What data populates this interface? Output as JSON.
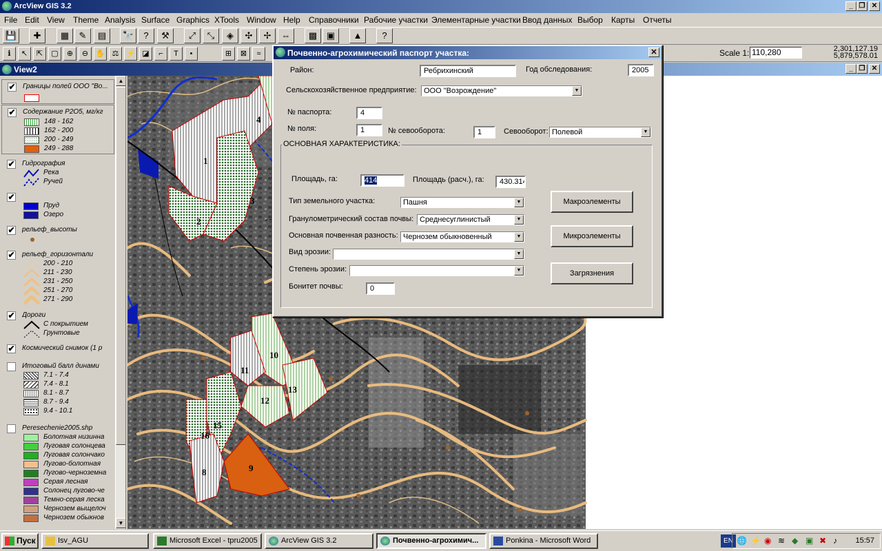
{
  "app": {
    "title": "ArcView GIS 3.2"
  },
  "menu": [
    "File",
    "Edit",
    "View",
    "Theme",
    "Analysis",
    "Surface",
    "Graphics",
    "XTools",
    "Window",
    "Help",
    "Справочники",
    "Рабочие участки",
    "Элементарные участки",
    "Ввод данных",
    "Выбор",
    "Карты",
    "Отчеты"
  ],
  "toolbar": {
    "scale_label": "Scale 1:",
    "scale_value": "110,280",
    "coord_x": "2,301,127.19",
    "coord_y": "5,879,578.01"
  },
  "view": {
    "title": "View2"
  },
  "toc": {
    "themes": [
      {
        "title": "Границы полей ООО \"Во...",
        "items": [
          {
            "label": "",
            "color": "#ffffff"
          }
        ]
      },
      {
        "title": "Содержание P2O5, мг/кг",
        "items": [
          {
            "label": "148 - 162",
            "color": "#eaffd8"
          },
          {
            "label": "162 - 200",
            "color": "#ffffff"
          },
          {
            "label": "200 - 249",
            "color": "#8fc08f"
          },
          {
            "label": "249 - 288",
            "color": "#e06010"
          }
        ]
      },
      {
        "title": "Гидрография",
        "items": [
          {
            "label": "Река"
          },
          {
            "label": "Ручей"
          }
        ]
      },
      {
        "title": "",
        "items": [
          {
            "label": "Пруд",
            "color": "#0000cc"
          },
          {
            "label": "Озеро",
            "color": "#1010a0"
          }
        ]
      },
      {
        "title": "рельеф_высоты",
        "items": []
      },
      {
        "title": "рельеф_горизонтали",
        "items": [
          {
            "label": "200 - 210"
          },
          {
            "label": "211 - 230"
          },
          {
            "label": "231 - 250"
          },
          {
            "label": "251 - 270"
          },
          {
            "label": "271 - 290"
          }
        ]
      },
      {
        "title": "Дороги",
        "items": [
          {
            "label": "С покрытием"
          },
          {
            "label": "Грунтовые"
          }
        ]
      },
      {
        "title": "Космический снимок (1 р",
        "items": []
      },
      {
        "title": "Итоговый балл динами",
        "items": [
          {
            "label": "7.1 - 7.4"
          },
          {
            "label": "7.4 - 8.1"
          },
          {
            "label": "8.1 - 8.7"
          },
          {
            "label": "8.7 - 9.4"
          },
          {
            "label": "9.4 - 10.1"
          }
        ]
      },
      {
        "title": "Peresechenie2005.shp",
        "items": [
          {
            "label": "Болотная низинна",
            "color": "#a0f0a0"
          },
          {
            "label": "Луговая солонцева",
            "color": "#40d040"
          },
          {
            "label": "Луговая солончако",
            "color": "#20b020"
          },
          {
            "label": "Лугово-болотная",
            "color": "#f0c090"
          },
          {
            "label": "Лугово-черноземна",
            "color": "#208020"
          },
          {
            "label": "Серая лесная",
            "color": "#c040c0"
          },
          {
            "label": "Солонец лугово-че",
            "color": "#303090"
          },
          {
            "label": "Темно-серая леска",
            "color": "#a040a0"
          },
          {
            "label": "Чернозем выщелоч",
            "color": "#d0a080"
          },
          {
            "label": "Чернозем обыкнов",
            "color": "#c07040"
          }
        ]
      }
    ]
  },
  "map": {
    "field_numbers": [
      "1",
      "2",
      "3",
      "4",
      "8",
      "9",
      "10",
      "11",
      "12",
      "13",
      "15",
      "16"
    ]
  },
  "dialog": {
    "title": "Почвенно-агрохимический паспорт участка:",
    "district_label": "Район:",
    "district_value": "Ребрихинский",
    "year_label": "Год обследования:",
    "year_value": "2005",
    "enterprise_label": "Сельскохозяйственное предприятие:",
    "enterprise_value": "ООО \"Возрождение\"",
    "passport_label": "№ паспорта:",
    "passport_value": "4",
    "field_label": "№ поля:",
    "field_value": "1",
    "rotation_no_label": "№ севооборота:",
    "rotation_no_value": "1",
    "rotation_label": "Севооборот:",
    "rotation_value": "Полевой",
    "group_label": "ОСНОВНАЯ ХАРАКТЕРИСТИКА:",
    "area_label": "Площадь, га:",
    "area_value": "414",
    "area_calc_label": "Площадь (расч.), га:",
    "area_calc_value": "430.314",
    "land_type_label": "Тип земельного участка:",
    "land_type_value": "Пашня",
    "granulometric_label": "Гранулометрический состав почвы:",
    "granulometric_value": "Среднесуглинистый",
    "soil_label": "Основная почвенная разность:",
    "soil_value": "Чернозем обыкновенный",
    "erosion_type_label": "Вид эрозии:",
    "erosion_type_value": "",
    "erosion_degree_label": "Степень эрозии:",
    "erosion_degree_value": "",
    "bonitet_label": "Бонитет почвы:",
    "bonitet_value": "0",
    "btn_macro": "Макроэлементы",
    "btn_micro": "Микроэлементы",
    "btn_pollution": "Загрязнения"
  },
  "taskbar": {
    "start": "Пуск",
    "tasks": [
      "Isv_AGU",
      "Microsoft Excel - tpru2005",
      "ArcView GIS 3.2",
      "Почвенно-агрохимич...",
      "Ponkina - Microsoft Word"
    ],
    "lang": "EN",
    "clock": "15:57"
  }
}
